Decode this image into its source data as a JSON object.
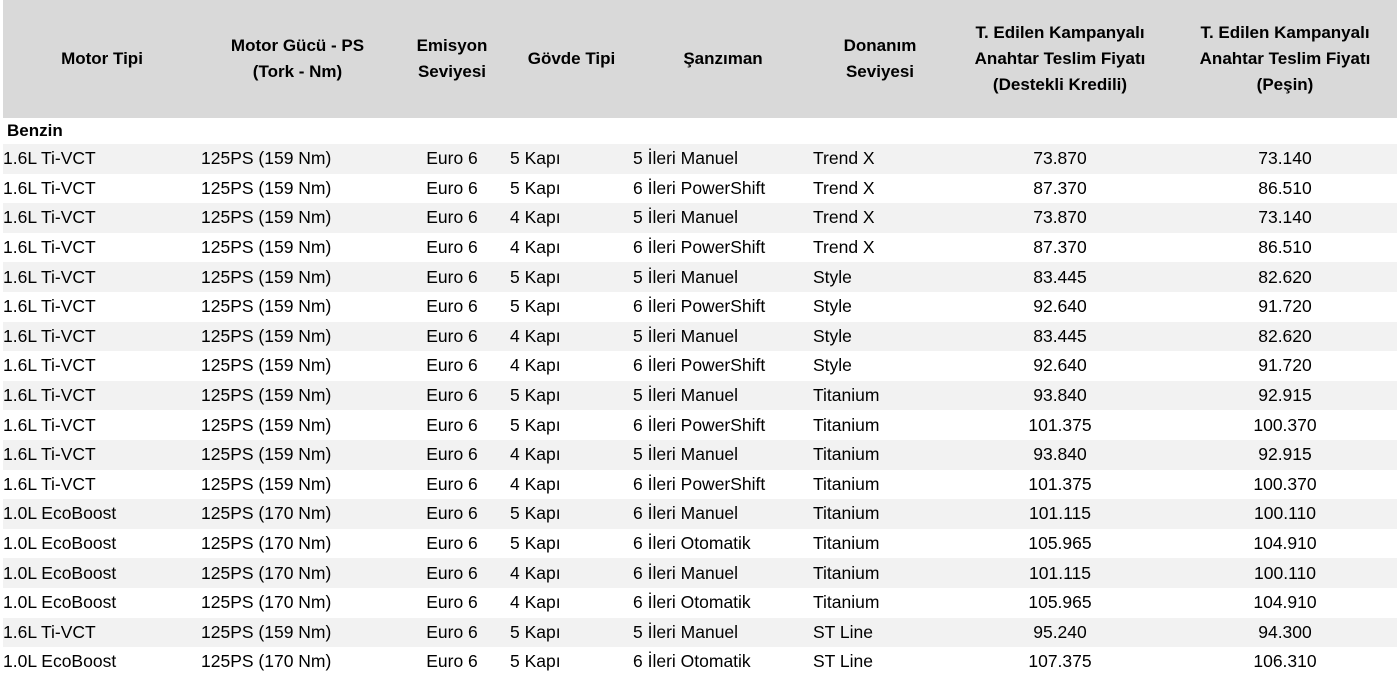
{
  "headers": {
    "motor": "Motor Tipi",
    "guc_line1": "Motor Gücü - PS",
    "guc_line2": "(Tork - Nm)",
    "emisyon_line1": "Emisyon",
    "emisyon_line2": "Seviyesi",
    "govde": "Gövde Tipi",
    "sanziman": "Şanzıman",
    "donanim_line1": "Donanım",
    "donanim_line2": "Seviyesi",
    "fiyat_kredi_line1": "T. Edilen Kampanyalı",
    "fiyat_kredi_line2": "Anahtar Teslim Fiyatı",
    "fiyat_kredi_line3": "(Destekli Kredili)",
    "fiyat_pesin_line1": "T. Edilen Kampanyalı",
    "fiyat_pesin_line2": "Anahtar Teslim Fiyatı",
    "fiyat_pesin_line3": "(Peşin)"
  },
  "section_label": "Benzin",
  "rows": [
    {
      "motor": "1.6L Ti-VCT",
      "guc": "125PS (159 Nm)",
      "emisyon": "Euro 6",
      "govde": "5 Kapı",
      "sanziman": "5 İleri Manuel",
      "donanim": "Trend X",
      "fiyat_kredi": "73.870",
      "fiyat_pesin": "73.140"
    },
    {
      "motor": "1.6L Ti-VCT",
      "guc": "125PS (159 Nm)",
      "emisyon": "Euro 6",
      "govde": "5 Kapı",
      "sanziman": "6 İleri PowerShift",
      "donanim": "Trend X",
      "fiyat_kredi": "87.370",
      "fiyat_pesin": "86.510"
    },
    {
      "motor": "1.6L Ti-VCT",
      "guc": "125PS (159 Nm)",
      "emisyon": "Euro 6",
      "govde": "4 Kapı",
      "sanziman": "5 İleri Manuel",
      "donanim": "Trend X",
      "fiyat_kredi": "73.870",
      "fiyat_pesin": "73.140"
    },
    {
      "motor": "1.6L Ti-VCT",
      "guc": "125PS (159 Nm)",
      "emisyon": "Euro 6",
      "govde": "4 Kapı",
      "sanziman": "6 İleri PowerShift",
      "donanim": "Trend X",
      "fiyat_kredi": "87.370",
      "fiyat_pesin": "86.510"
    },
    {
      "motor": "1.6L Ti-VCT",
      "guc": "125PS (159 Nm)",
      "emisyon": "Euro 6",
      "govde": "5 Kapı",
      "sanziman": "5 İleri Manuel",
      "donanim": "Style",
      "fiyat_kredi": "83.445",
      "fiyat_pesin": "82.620"
    },
    {
      "motor": "1.6L Ti-VCT",
      "guc": "125PS (159 Nm)",
      "emisyon": "Euro 6",
      "govde": "5 Kapı",
      "sanziman": "6 İleri PowerShift",
      "donanim": "Style",
      "fiyat_kredi": "92.640",
      "fiyat_pesin": "91.720"
    },
    {
      "motor": "1.6L Ti-VCT",
      "guc": "125PS (159 Nm)",
      "emisyon": "Euro 6",
      "govde": "4 Kapı",
      "sanziman": "5 İleri Manuel",
      "donanim": "Style",
      "fiyat_kredi": "83.445",
      "fiyat_pesin": "82.620"
    },
    {
      "motor": "1.6L Ti-VCT",
      "guc": "125PS (159 Nm)",
      "emisyon": "Euro 6",
      "govde": "4 Kapı",
      "sanziman": "6 İleri PowerShift",
      "donanim": "Style",
      "fiyat_kredi": "92.640",
      "fiyat_pesin": "91.720"
    },
    {
      "motor": "1.6L Ti-VCT",
      "guc": "125PS (159 Nm)",
      "emisyon": "Euro 6",
      "govde": "5 Kapı",
      "sanziman": "5 İleri Manuel",
      "donanim": "Titanium",
      "fiyat_kredi": "93.840",
      "fiyat_pesin": "92.915"
    },
    {
      "motor": "1.6L Ti-VCT",
      "guc": "125PS (159 Nm)",
      "emisyon": "Euro 6",
      "govde": "5 Kapı",
      "sanziman": "6 İleri PowerShift",
      "donanim": "Titanium",
      "fiyat_kredi": "101.375",
      "fiyat_pesin": "100.370"
    },
    {
      "motor": "1.6L Ti-VCT",
      "guc": "125PS (159 Nm)",
      "emisyon": "Euro 6",
      "govde": "4 Kapı",
      "sanziman": "5 İleri Manuel",
      "donanim": "Titanium",
      "fiyat_kredi": "93.840",
      "fiyat_pesin": "92.915"
    },
    {
      "motor": "1.6L Ti-VCT",
      "guc": "125PS (159 Nm)",
      "emisyon": "Euro 6",
      "govde": "4 Kapı",
      "sanziman": "6 İleri PowerShift",
      "donanim": "Titanium",
      "fiyat_kredi": "101.375",
      "fiyat_pesin": "100.370"
    },
    {
      "motor": "1.0L EcoBoost",
      "guc": "125PS (170 Nm)",
      "emisyon": "Euro 6",
      "govde": "5 Kapı",
      "sanziman": "6 İleri Manuel",
      "donanim": "Titanium",
      "fiyat_kredi": "101.115",
      "fiyat_pesin": "100.110"
    },
    {
      "motor": "1.0L EcoBoost",
      "guc": "125PS (170 Nm)",
      "emisyon": "Euro 6",
      "govde": "5 Kapı",
      "sanziman": "6 İleri Otomatik",
      "donanim": "Titanium",
      "fiyat_kredi": "105.965",
      "fiyat_pesin": "104.910"
    },
    {
      "motor": "1.0L EcoBoost",
      "guc": "125PS (170 Nm)",
      "emisyon": "Euro 6",
      "govde": "4 Kapı",
      "sanziman": "6 İleri Manuel",
      "donanim": "Titanium",
      "fiyat_kredi": "101.115",
      "fiyat_pesin": "100.110"
    },
    {
      "motor": "1.0L EcoBoost",
      "guc": "125PS (170 Nm)",
      "emisyon": "Euro 6",
      "govde": "4 Kapı",
      "sanziman": "6 İleri Otomatik",
      "donanim": "Titanium",
      "fiyat_kredi": "105.965",
      "fiyat_pesin": "104.910"
    },
    {
      "motor": "1.6L Ti-VCT",
      "guc": "125PS (159 Nm)",
      "emisyon": "Euro 6",
      "govde": "5 Kapı",
      "sanziman": "5 İleri Manuel",
      "donanim": "ST Line",
      "fiyat_kredi": "95.240",
      "fiyat_pesin": "94.300"
    },
    {
      "motor": "1.0L EcoBoost",
      "guc": "125PS (170 Nm)",
      "emisyon": "Euro 6",
      "govde": "5 Kapı",
      "sanziman": "6 İleri Otomatik",
      "donanim": "ST Line",
      "fiyat_kredi": "107.375",
      "fiyat_pesin": "106.310"
    }
  ],
  "colors": {
    "header_bg": "#d9d9d9",
    "stripe_bg": "#f2f2f2"
  }
}
